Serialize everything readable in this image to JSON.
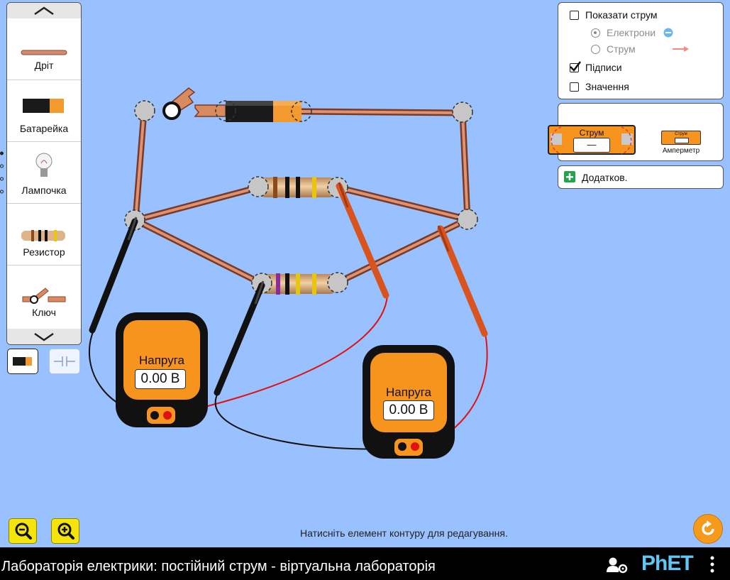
{
  "toolbox": {
    "items": [
      {
        "label": "Дріт",
        "icon": "wire-icon"
      },
      {
        "label": "Батарейка",
        "icon": "battery-icon"
      },
      {
        "label": "Лампочка",
        "icon": "lightbulb-icon"
      },
      {
        "label": "Резистор",
        "icon": "resistor-icon"
      },
      {
        "label": "Ключ",
        "icon": "switch-icon"
      }
    ]
  },
  "options": {
    "show_current": "Показати струм",
    "electrons": "Електрони",
    "conventional": "Струм",
    "labels": "Підписи",
    "values": "Значення",
    "show_current_checked": false,
    "electrons_selected": true,
    "labels_checked": true,
    "values_checked": false
  },
  "sensors": {
    "ammeter_display_label": "Струм",
    "ammeter_display_value": "—",
    "ammeter_icon_label": "Струм",
    "ammeter_name": "Амперметр"
  },
  "advanced": {
    "label": "Додатков."
  },
  "voltmeters": [
    {
      "label": "Напруга",
      "value": "0.00 В"
    },
    {
      "label": "Напруга",
      "value": "0.00 В"
    }
  ],
  "hint": "Натисніть елемент контуру для редагування.",
  "footer": {
    "title": "Лабораторія електрики: постійний струм - віртуальна лабораторія",
    "brand": "PhET"
  },
  "colors": {
    "background": "#99c1ff",
    "wire": "#c87b5c",
    "meter_body": "#f7941d",
    "zoom_button": "#f4e40a"
  }
}
